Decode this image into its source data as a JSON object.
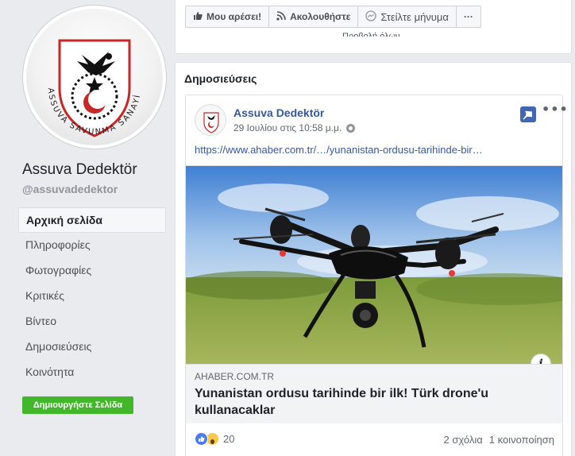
{
  "page": {
    "name": "Assuva Dedektör",
    "handle": "@assuvadedektor",
    "logo_text": "ASSUVA SAVUNMA SANAYİ"
  },
  "nav": {
    "items": [
      {
        "label": "Αρχική σελίδα",
        "active": true
      },
      {
        "label": "Πληροφορίες"
      },
      {
        "label": "Φωτογραφίες"
      },
      {
        "label": "Κριτικές"
      },
      {
        "label": "Βίντεο"
      },
      {
        "label": "Δημοσιεύσεις"
      },
      {
        "label": "Κοινότητα"
      }
    ],
    "create_page": "Δημιουργήστε Σελίδα"
  },
  "actions": {
    "like": "Μου αρέσει!",
    "follow": "Ακολουθήστε",
    "message": "Στείλτε μήνυμα",
    "more": "···",
    "cut_text": "Προβολή όλων"
  },
  "posts": {
    "title": "Δημοσιεύσεις",
    "items": [
      {
        "author": "Assuva Dedektör",
        "time": "29 Ιουλίου στις 10:58 μ.μ.",
        "link_text": "https://www.ahaber.com.tr/…/yunanistan-ordusu-tarihinde-bir…",
        "link_domain": "AHABER.COM.TR",
        "link_title": "Yunanistan ordusu tarihinde bir ilk! Türk drone'u kullanacaklar",
        "reaction_count": "20",
        "comments": "2 σχόλια",
        "shares": "1 κοινοποίηση",
        "reactions": [
          "like",
          "wow"
        ]
      }
    ]
  },
  "colors": {
    "link": "#385898",
    "author": "#365899",
    "create_button": "#42b72a",
    "pin": "#4267b2"
  }
}
